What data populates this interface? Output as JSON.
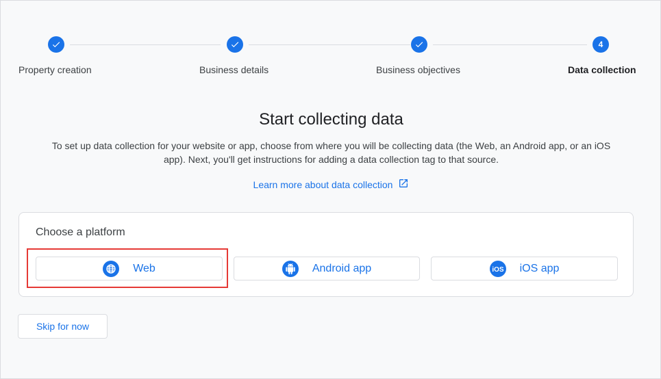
{
  "stepper": {
    "steps": [
      {
        "label": "Property creation",
        "state": "complete",
        "number": "1"
      },
      {
        "label": "Business details",
        "state": "complete",
        "number": "2"
      },
      {
        "label": "Business objectives",
        "state": "complete",
        "number": "3"
      },
      {
        "label": "Data collection",
        "state": "active",
        "number": "4"
      }
    ]
  },
  "main": {
    "title": "Start collecting data",
    "description": "To set up data collection for your website or app, choose from where you will be collecting data (the Web, an Android app, or an iOS app). Next, you'll get instructions for adding a data collection tag to that source.",
    "learn_more_link": "Learn more about data collection",
    "learn_more_icon": "open-in-new-icon"
  },
  "platform_card": {
    "title": "Choose a platform",
    "buttons": [
      {
        "label": "Web",
        "icon": "globe-icon",
        "highlighted": true
      },
      {
        "label": "Android app",
        "icon": "android-icon",
        "highlighted": false
      },
      {
        "label": "iOS app",
        "icon": "ios-icon",
        "highlighted": false
      }
    ]
  },
  "footer": {
    "skip_label": "Skip for now"
  },
  "colors": {
    "accent": "#1a73e8",
    "highlight": "#e53935",
    "background": "#f8f9fa"
  }
}
